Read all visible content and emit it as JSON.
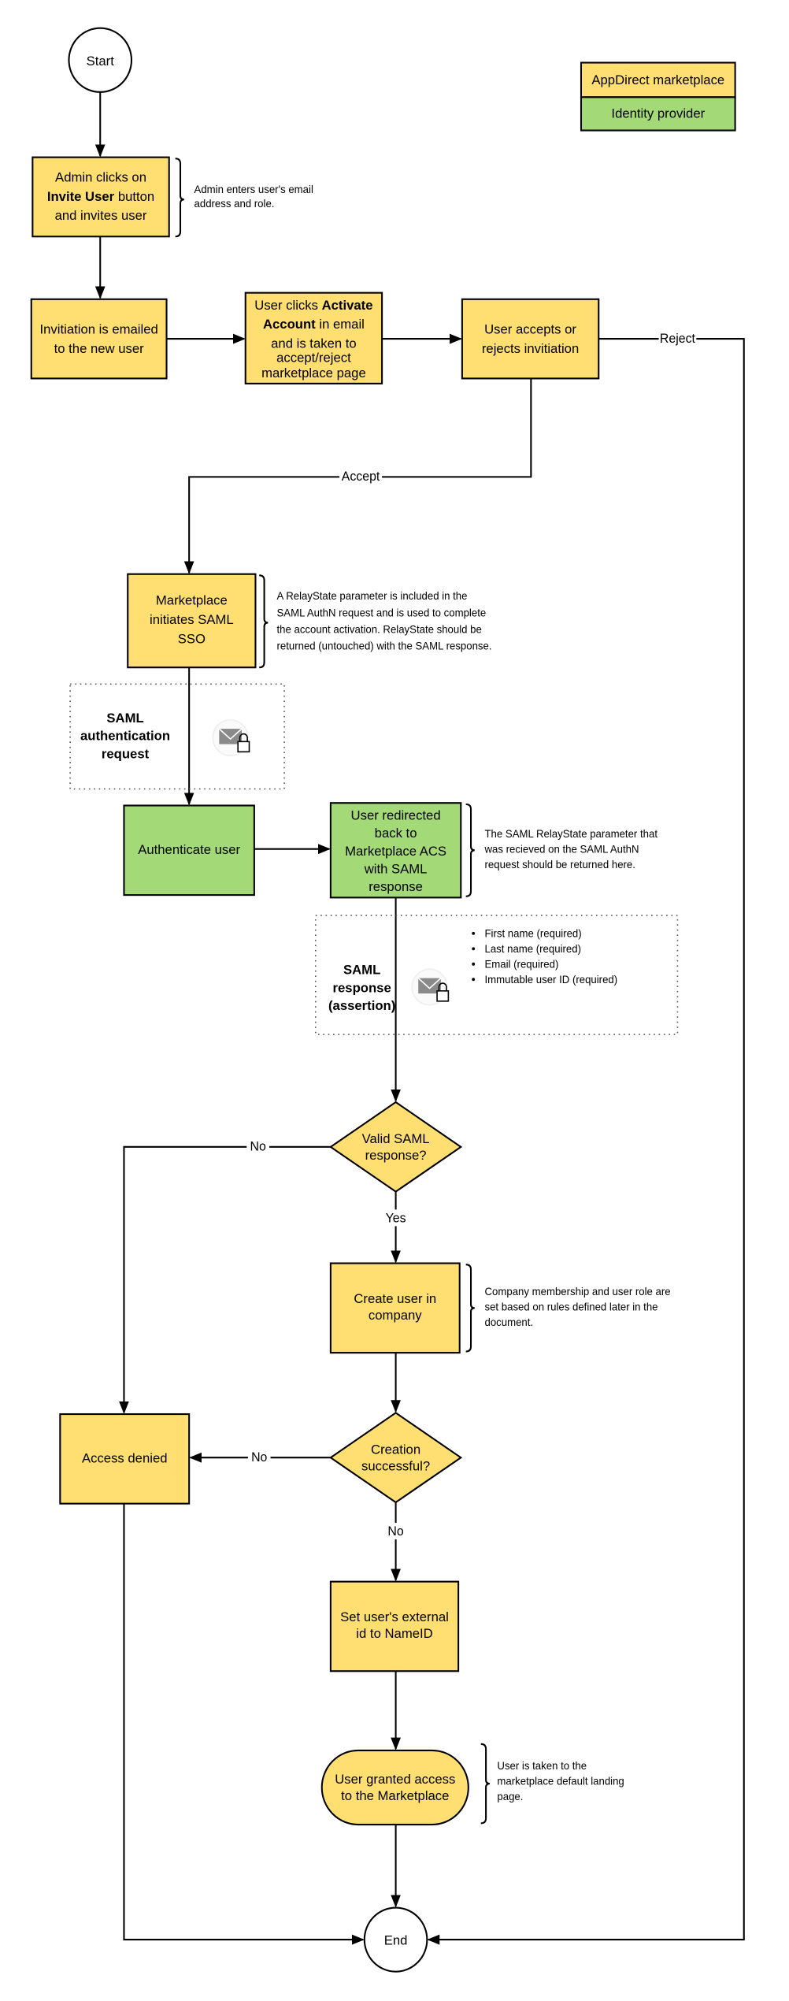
{
  "colors": {
    "marketplace": "#FFDF71",
    "identity_provider": "#A3D977",
    "stroke": "#000000"
  },
  "legend": {
    "marketplace": "AppDirect marketplace",
    "identity_provider": "Identity provider"
  },
  "nodes": {
    "start": "Start",
    "end": "End",
    "admin_invite": {
      "l1": "Admin clicks on",
      "l2_bold": "Invite User",
      "l2_rest": " button",
      "l3": "and invites user"
    },
    "invitation_emailed": {
      "l1": "Invitiation is emailed",
      "l2": "to the new user"
    },
    "activate": {
      "l1_pre": "User clicks ",
      "l1_bold": "Activate",
      "l2_bold": "Account",
      "l2_rest": " in email",
      "l3": "and is taken to",
      "l4": "accept/reject",
      "l5": "marketplace page"
    },
    "accepts_rejects": {
      "l1": "User accepts or",
      "l2": "rejects invitiation"
    },
    "initiates_sso": {
      "l1": "Marketplace",
      "l2": "initiates SAML",
      "l3": "SSO"
    },
    "authenticate": "Authenticate user",
    "redirected": {
      "l1": "User redirected",
      "l2": "back to",
      "l3": "Marketplace ACS",
      "l4": "with SAML",
      "l5": "response"
    },
    "valid_saml": {
      "l1": "Valid SAML",
      "l2": "response?"
    },
    "create_user": {
      "l1": "Create user in",
      "l2": "company"
    },
    "creation_ok": {
      "l1": "Creation",
      "l2": "successful?"
    },
    "access_denied": "Access denied",
    "set_external_id": {
      "l1": "Set user's external",
      "l2": "id to NameID"
    },
    "granted": {
      "l1": "User granted access",
      "l2": "to the Marketplace"
    }
  },
  "edge_labels": {
    "reject": "Reject",
    "accept": "Accept",
    "no_valid": "No",
    "yes_valid": "Yes",
    "no_creation_left": "No",
    "no_creation_down": "No"
  },
  "annotations": {
    "admin": [
      "Admin enters user's email",
      "address and role."
    ],
    "relaystate": [
      "A RelayState parameter is included in the",
      "SAML AuthN request and is used to complete",
      "the account activation. RelayState should be",
      "returned (untouched) with the SAML response."
    ],
    "redirect": [
      "The SAML RelayState parameter that",
      "was recieved on the SAML AuthN",
      "request should be returned here."
    ],
    "create": [
      "Company membership and user role are",
      "set based on rules defined later in the",
      "document."
    ],
    "granted": [
      "User is taken to the",
      "marketplace default landing",
      "page."
    ]
  },
  "messages": {
    "authn_request": {
      "title": [
        "SAML",
        "authentication",
        "request"
      ],
      "icon": "locked-envelope-icon"
    },
    "saml_response": {
      "title": [
        "SAML",
        "response",
        "(assertion)"
      ],
      "icon": "locked-envelope-icon",
      "attributes": [
        "First name (required)",
        "Last name (required)",
        "Email (required)",
        "Immutable user ID (required)"
      ]
    }
  }
}
